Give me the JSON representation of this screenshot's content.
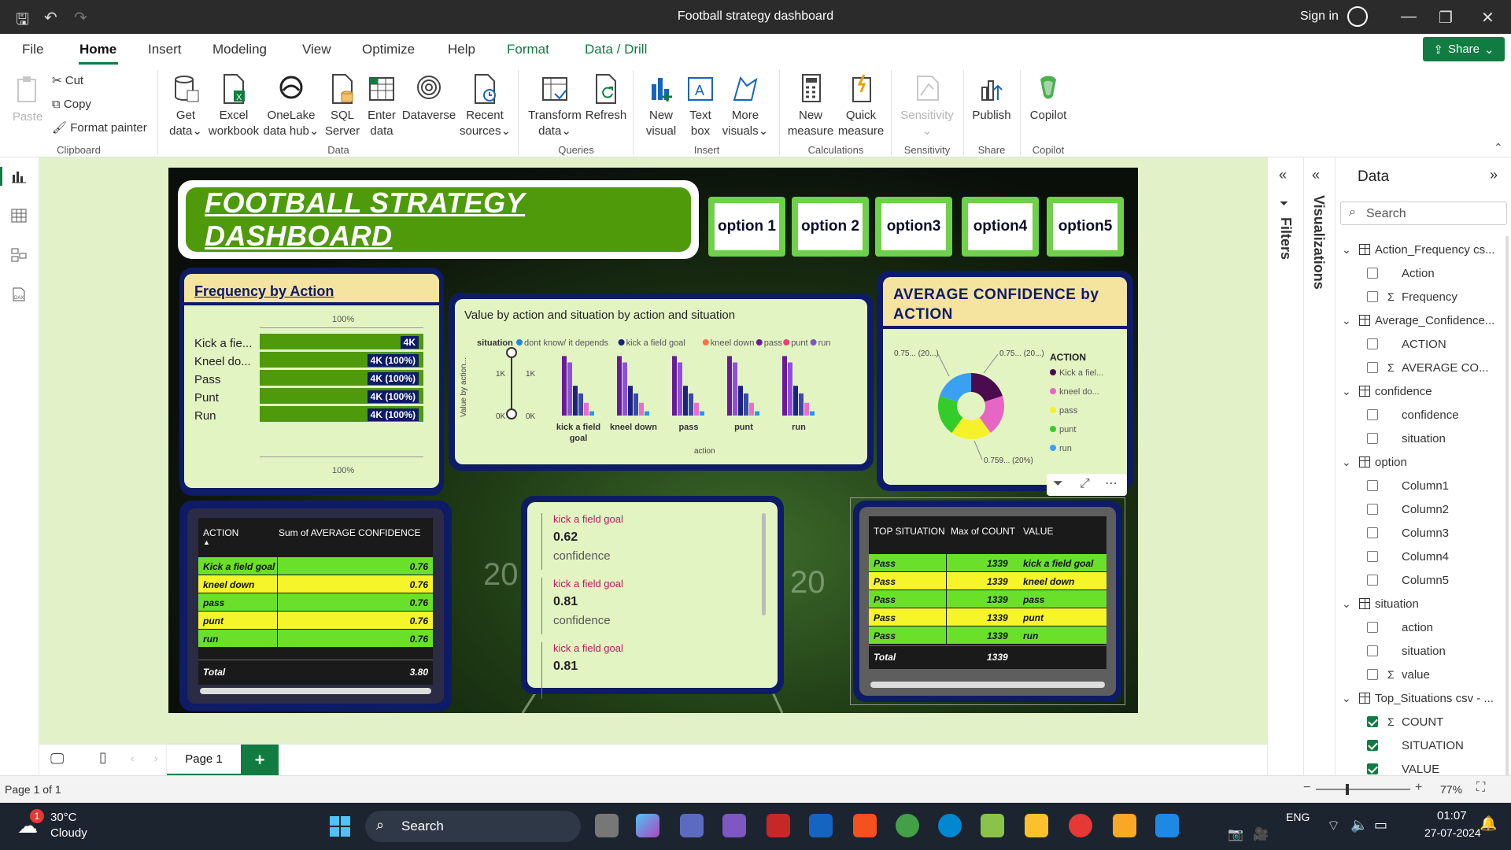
{
  "window": {
    "title": "Football strategy dashboard",
    "sign_in": "Sign in"
  },
  "menu": {
    "items": [
      "File",
      "Home",
      "Insert",
      "Modeling",
      "View",
      "Optimize",
      "Help",
      "Format",
      "Data / Drill"
    ],
    "share": "Share"
  },
  "ribbon": {
    "clipboard": {
      "paste": "Paste",
      "cut": "Cut",
      "copy": "Copy",
      "format_painter": "Format painter",
      "group": "Clipboard"
    },
    "data": {
      "get_data": [
        "Get",
        "data"
      ],
      "excel": [
        "Excel",
        "workbook"
      ],
      "onelake": [
        "OneLake",
        "data hub"
      ],
      "sql": [
        "SQL",
        "Server"
      ],
      "enter": [
        "Enter",
        "data"
      ],
      "dataverse": "Dataverse",
      "recent": [
        "Recent",
        "sources"
      ],
      "group": "Data"
    },
    "queries": {
      "transform": [
        "Transform",
        "data"
      ],
      "refresh": "Refresh",
      "group": "Queries"
    },
    "insert": {
      "new_visual": [
        "New",
        "visual"
      ],
      "text_box": [
        "Text",
        "box"
      ],
      "more_visuals": [
        "More",
        "visuals"
      ],
      "group": "Insert"
    },
    "calculations": {
      "new_measure": [
        "New",
        "measure"
      ],
      "quick_measure": [
        "Quick",
        "measure"
      ],
      "group": "Calculations"
    },
    "sensitivity": {
      "label": "Sensitivity",
      "group": "Sensitivity"
    },
    "share": {
      "publish": "Publish",
      "group": "Share"
    },
    "copilot": {
      "label": "Copilot",
      "group": "Copilot"
    }
  },
  "dashboard": {
    "title": "FOOTBALL STRATEGY DASHBOARD",
    "options": [
      "option 1",
      "option 2",
      "option3",
      "option4",
      "option5"
    ],
    "frequency": {
      "title": "Frequency by Action",
      "pct_top": "100%",
      "pct_bottom": "100%",
      "rows": [
        {
          "label": "Kick a fie...",
          "value": "4K"
        },
        {
          "label": "Kneel do...",
          "value": "4K (100%)"
        },
        {
          "label": "Pass",
          "value": "4K (100%)"
        },
        {
          "label": "Punt",
          "value": "4K (100%)"
        },
        {
          "label": "Run",
          "value": "4K (100%)"
        }
      ]
    },
    "value_chart": {
      "title": "Value by action and situation by action and situation",
      "ylabel": "Value by action...",
      "slider_top": "1K",
      "slider_bottom": "0K"
    },
    "avg_conf": {
      "title": "AVERAGE CONFIDENCE by ACTION",
      "labels": [
        "0.75... (20...)",
        "0.75... (20...)",
        "0.759... (20%)"
      ]
    },
    "avg_table": {
      "headers": [
        "ACTION",
        "Sum of AVERAGE CONFIDENCE"
      ],
      "rows": [
        {
          "action": "Kick a field goal",
          "value": "0.76"
        },
        {
          "action": "kneel down",
          "value": "0.76"
        },
        {
          "action": "pass",
          "value": "0.76"
        },
        {
          "action": "punt",
          "value": "0.76"
        },
        {
          "action": "run",
          "value": "0.76"
        }
      ],
      "total_label": "Total",
      "total_value": "3.80"
    },
    "confidence_list": [
      {
        "name": "kick a field goal",
        "value": "0.62",
        "label": "confidence"
      },
      {
        "name": "kick a field goal",
        "value": "0.81",
        "label": "confidence"
      },
      {
        "name": "kick a field goal",
        "value": "0.81",
        "label": ""
      }
    ],
    "top_table": {
      "headers": [
        "TOP SITUATION",
        "Max of COUNT",
        "VALUE"
      ],
      "rows": [
        {
          "situation": "Pass",
          "count": "1339",
          "value": "kick a field goal"
        },
        {
          "situation": "Pass",
          "count": "1339",
          "value": "kneel down"
        },
        {
          "situation": "Pass",
          "count": "1339",
          "value": "pass"
        },
        {
          "situation": "Pass",
          "count": "1339",
          "value": "punt"
        },
        {
          "situation": "Pass",
          "count": "1339",
          "value": "run"
        }
      ],
      "total_label": "Total",
      "total_value": "1339"
    }
  },
  "chart_data": [
    {
      "type": "bar",
      "title": "Value by action and situation by action and situation",
      "xlabel": "action",
      "ylabel": "Value by action...",
      "legend_title": "situation",
      "legend_position": "top",
      "categories": [
        "kick a field goal",
        "kneel down",
        "pass",
        "punt",
        "run"
      ],
      "yticks": [
        "0K",
        "1K"
      ],
      "series": [
        {
          "name": "dont know/ it depends",
          "color": "#6a1b9a",
          "values": [
            1400,
            1400,
            1400,
            1400,
            1400
          ]
        },
        {
          "name": "kick a field goal",
          "color": "#8e4fe0",
          "values": [
            1250,
            1250,
            1250,
            1250,
            1250
          ]
        },
        {
          "name": "kneel down",
          "color": "#1a237e",
          "values": [
            700,
            700,
            700,
            700,
            700
          ]
        },
        {
          "name": "pass",
          "color": "#3949ab",
          "values": [
            520,
            520,
            520,
            520,
            520
          ]
        },
        {
          "name": "punt",
          "color": "#ec6ec8",
          "values": [
            300,
            300,
            300,
            300,
            300
          ]
        },
        {
          "name": "run",
          "color": "#2196f3",
          "values": [
            100,
            100,
            100,
            100,
            100
          ]
        }
      ],
      "legend_colors": [
        "#1e88e5",
        "#1a237e",
        "#ff7043",
        "#6a1b9a",
        "#ec407a",
        "#7e57c2"
      ]
    },
    {
      "type": "pie",
      "title": "AVERAGE CONFIDENCE by ACTION",
      "legend_title": "ACTION",
      "legend_position": "right",
      "categories": [
        "Kick a fiel...",
        "kneel do...",
        "pass",
        "punt",
        "run"
      ],
      "values": [
        0.76,
        0.76,
        0.76,
        0.76,
        0.76
      ],
      "colors": [
        "#4a0b4f",
        "#e866c3",
        "#f5f22a",
        "#34cc2a",
        "#3aa0f0"
      ]
    }
  ],
  "panes": {
    "filters": "Filters",
    "visualizations": "Visualizations",
    "data_title": "Data",
    "search_placeholder": "Search",
    "tree": [
      {
        "kind": "table",
        "label": "Action_Frequency cs..."
      },
      {
        "kind": "field",
        "label": "Action",
        "sigma": false,
        "checked": false
      },
      {
        "kind": "field",
        "label": "Frequency",
        "sigma": true,
        "checked": false
      },
      {
        "kind": "table",
        "label": "Average_Confidence..."
      },
      {
        "kind": "field",
        "label": "ACTION",
        "sigma": false,
        "checked": false
      },
      {
        "kind": "field",
        "label": "AVERAGE CO...",
        "sigma": true,
        "checked": false
      },
      {
        "kind": "table",
        "label": "confidence"
      },
      {
        "kind": "field",
        "label": "confidence",
        "sigma": false,
        "checked": false
      },
      {
        "kind": "field",
        "label": "situation",
        "sigma": false,
        "checked": false
      },
      {
        "kind": "table",
        "label": "option"
      },
      {
        "kind": "field",
        "label": "Column1",
        "sigma": false,
        "checked": false
      },
      {
        "kind": "field",
        "label": "Column2",
        "sigma": false,
        "checked": false
      },
      {
        "kind": "field",
        "label": "Column3",
        "sigma": false,
        "checked": false
      },
      {
        "kind": "field",
        "label": "Column4",
        "sigma": false,
        "checked": false
      },
      {
        "kind": "field",
        "label": "Column5",
        "sigma": false,
        "checked": false
      },
      {
        "kind": "table",
        "label": "situation"
      },
      {
        "kind": "field",
        "label": "action",
        "sigma": false,
        "checked": false
      },
      {
        "kind": "field",
        "label": "situation",
        "sigma": false,
        "checked": false
      },
      {
        "kind": "field",
        "label": "value",
        "sigma": true,
        "checked": false
      },
      {
        "kind": "table",
        "label": "Top_Situations csv - ..."
      },
      {
        "kind": "field",
        "label": "COUNT",
        "sigma": true,
        "checked": true
      },
      {
        "kind": "field",
        "label": "SITUATION",
        "sigma": false,
        "checked": true
      },
      {
        "kind": "field",
        "label": "VALUE",
        "sigma": false,
        "checked": true
      }
    ]
  },
  "pages": {
    "tab": "Page 1",
    "add": "+",
    "status": "Page 1 of 1",
    "zoom": "77%"
  },
  "taskbar": {
    "temp": "30°C",
    "weather": "Cloudy",
    "badge": "1",
    "search": "Search",
    "lang": "ENG",
    "time": "01:07",
    "date": "27-07-2024"
  }
}
